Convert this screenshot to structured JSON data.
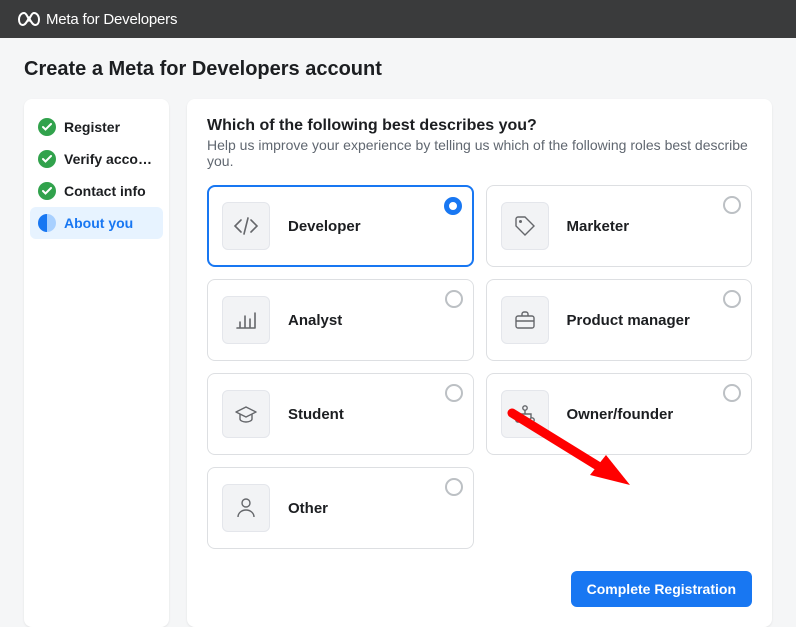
{
  "brand": "Meta for Developers",
  "pageTitle": "Create a Meta for Developers account",
  "steps": [
    {
      "label": "Register"
    },
    {
      "label": "Verify acco…"
    },
    {
      "label": "Contact info"
    },
    {
      "label": "About you"
    }
  ],
  "question": {
    "title": "Which of the following best describes you?",
    "subtitle": "Help us improve your experience by telling us which of the following roles best describe you."
  },
  "roles": [
    {
      "label": "Developer"
    },
    {
      "label": "Marketer"
    },
    {
      "label": "Analyst"
    },
    {
      "label": "Product manager"
    },
    {
      "label": "Student"
    },
    {
      "label": "Owner/founder"
    },
    {
      "label": "Other"
    }
  ],
  "submitLabel": "Complete Registration"
}
